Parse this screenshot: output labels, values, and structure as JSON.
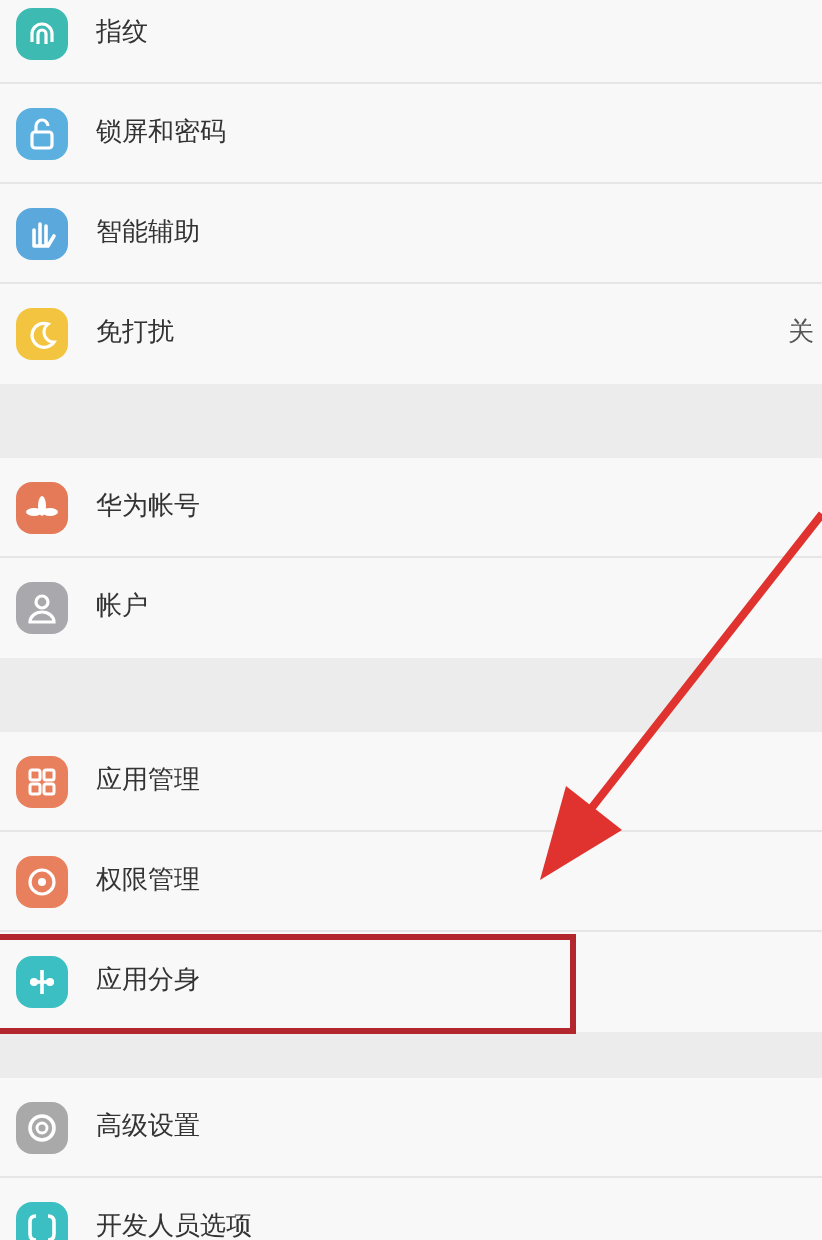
{
  "groups": [
    {
      "items": [
        {
          "label": "指纹",
          "highlighted": false
        },
        {
          "label": "锁屏和密码",
          "highlighted": false
        },
        {
          "label": "智能辅助",
          "highlighted": false
        },
        {
          "label": "免打扰",
          "value": "关",
          "highlighted": false
        }
      ]
    },
    {
      "items": [
        {
          "label": "华为帐号",
          "highlighted": false
        },
        {
          "label": "帐户",
          "highlighted": false
        }
      ]
    },
    {
      "items": [
        {
          "label": "应用管理",
          "highlighted": false
        },
        {
          "label": "权限管理",
          "highlighted": false
        },
        {
          "label": "应用分身",
          "highlighted": true
        }
      ]
    },
    {
      "items": [
        {
          "label": "高级设置",
          "highlighted": false
        },
        {
          "label": "开发人员选项",
          "highlighted": false
        }
      ]
    }
  ]
}
